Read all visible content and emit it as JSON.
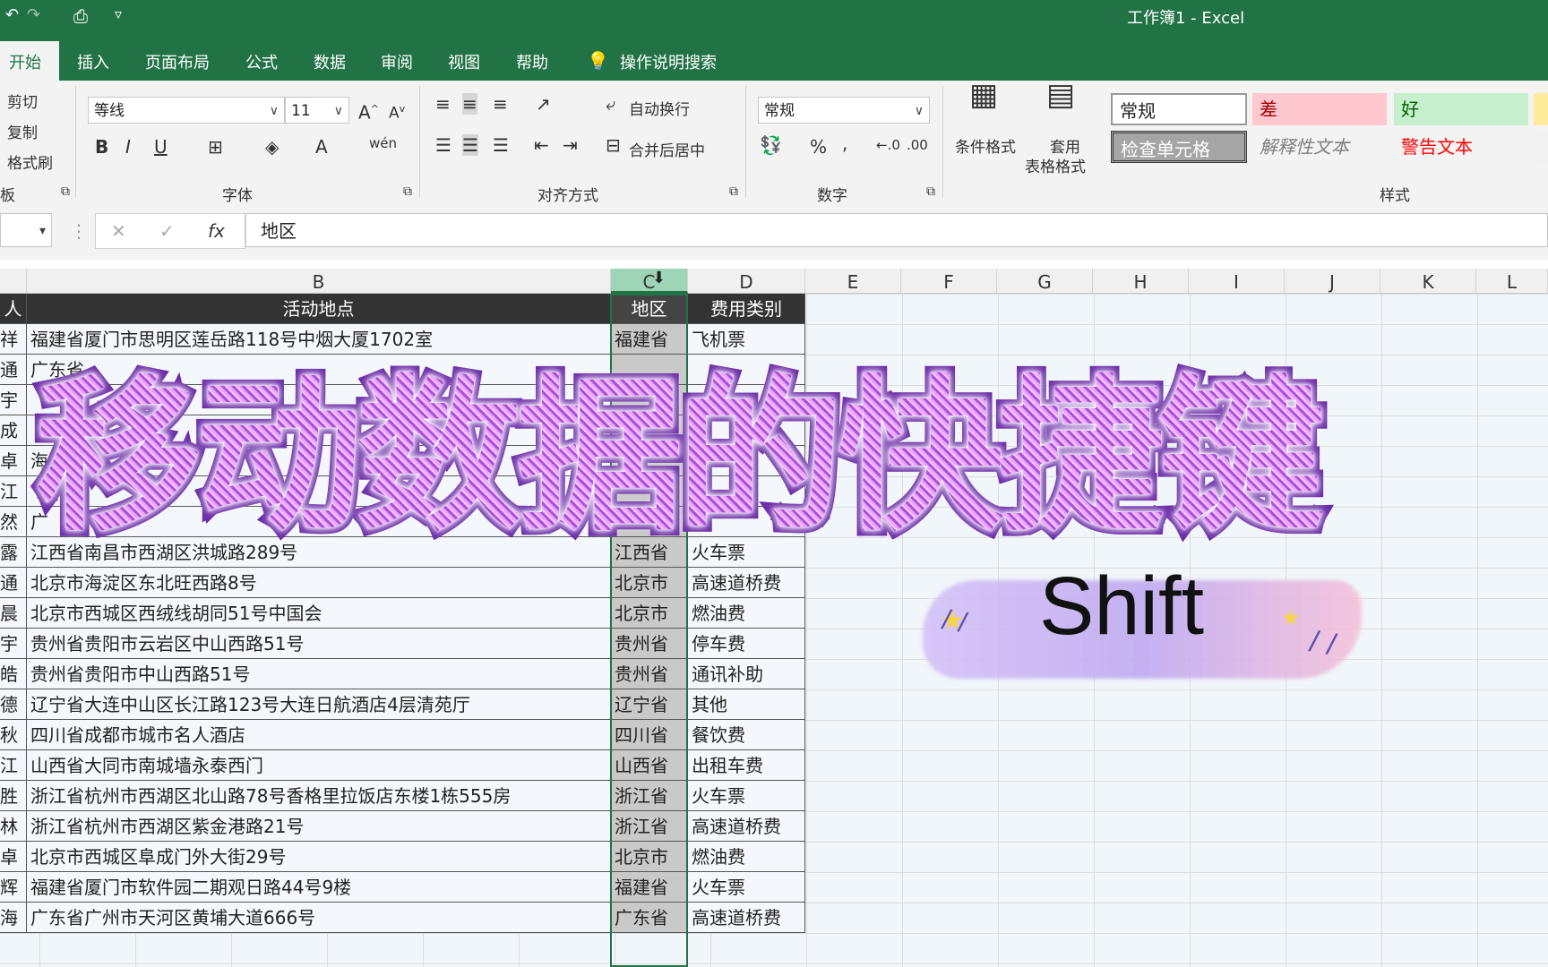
{
  "window": {
    "title": "工作簿1  -  Excel"
  },
  "ribbon_tabs": [
    "开始",
    "插入",
    "页面布局",
    "公式",
    "数据",
    "审阅",
    "视图",
    "帮助",
    "操作说明搜索"
  ],
  "clipboard": {
    "cut": "剪切",
    "copy": "复制",
    "format_painter": "格式刷",
    "group": "板"
  },
  "font": {
    "name": "等线",
    "size": "11",
    "group": "字体",
    "bold": "B",
    "italic": "I",
    "underline": "U",
    "font_color": "A",
    "phonetic": "wén"
  },
  "alignment": {
    "wrap": "自动换行",
    "merge": "合并后居中",
    "group": "对齐方式"
  },
  "number": {
    "format": "常规",
    "percent": "%",
    "comma": ",",
    "group": "数字"
  },
  "styles": {
    "conditional": "条件格式",
    "table_format_1": "套用",
    "table_format_2": "表格格式",
    "normal": "常规",
    "bad": "差",
    "good": "好",
    "check_cell": "检查单元格",
    "explanatory": "解释性文本",
    "warning": "警告文本",
    "group": "样式"
  },
  "formula_bar": {
    "cancel": "✕",
    "enter": "✓",
    "fx": "fx",
    "value": "地区"
  },
  "column_headers": [
    "B",
    "C",
    "D",
    "E",
    "F",
    "G",
    "H",
    "I",
    "J",
    "K",
    "L"
  ],
  "table": {
    "headers": {
      "a": "人",
      "b": "活动地点",
      "c": "地区",
      "d": "费用类别"
    },
    "rows": [
      {
        "a": "祥",
        "b": "福建省厦门市思明区莲岳路118号中烟大厦1702室",
        "c": "福建省",
        "d": "飞机票"
      },
      {
        "a": "通",
        "b": "广东省",
        "c": "",
        "d": ""
      },
      {
        "a": "宇",
        "b": "",
        "c": "",
        "d": ""
      },
      {
        "a": "成",
        "b": "",
        "c": "",
        "d": ""
      },
      {
        "a": "卓",
        "b": "海",
        "c": "",
        "d": ""
      },
      {
        "a": "江",
        "b": "",
        "c": "",
        "d": ""
      },
      {
        "a": "然",
        "b": "广",
        "c": "",
        "d": ""
      },
      {
        "a": "露",
        "b": "江西省南昌市西湖区洪城路289号",
        "c": "江西省",
        "d": "火车票"
      },
      {
        "a": "通",
        "b": "北京市海淀区东北旺西路8号",
        "c": "北京市",
        "d": "高速道桥费"
      },
      {
        "a": "晨",
        "b": "北京市西城区西绒线胡同51号中国会",
        "c": "北京市",
        "d": "燃油费"
      },
      {
        "a": "宇",
        "b": "贵州省贵阳市云岩区中山西路51号",
        "c": "贵州省",
        "d": "停车费"
      },
      {
        "a": "皓",
        "b": "贵州省贵阳市中山西路51号",
        "c": "贵州省",
        "d": "通讯补助"
      },
      {
        "a": "德",
        "b": "辽宁省大连中山区长江路123号大连日航酒店4层清苑厅",
        "c": "辽宁省",
        "d": "其他"
      },
      {
        "a": "秋",
        "b": "四川省成都市城市名人酒店",
        "c": "四川省",
        "d": "餐饮费"
      },
      {
        "a": "江",
        "b": "山西省大同市南城墙永泰西门",
        "c": "山西省",
        "d": "出租车费"
      },
      {
        "a": "胜",
        "b": "浙江省杭州市西湖区北山路78号香格里拉饭店东楼1栋555房",
        "c": "浙江省",
        "d": "火车票"
      },
      {
        "a": "林",
        "b": "浙江省杭州市西湖区紫金港路21号",
        "c": "浙江省",
        "d": "高速道桥费"
      },
      {
        "a": "卓",
        "b": "北京市西城区阜成门外大街29号",
        "c": "北京市",
        "d": "燃油费"
      },
      {
        "a": "辉",
        "b": "福建省厦门市软件园二期观日路44号9楼",
        "c": "福建省",
        "d": "火车票"
      },
      {
        "a": "海",
        "b": "广东省广州市天河区黄埔大道666号",
        "c": "广东省",
        "d": "高速道桥费"
      }
    ]
  },
  "overlay": {
    "title": "移动数据的快捷键",
    "key": "Shift"
  },
  "colors": {
    "excel_green": "#217346",
    "title_purple": "#c86ee6",
    "title_stroke": "#6b2aa8"
  }
}
